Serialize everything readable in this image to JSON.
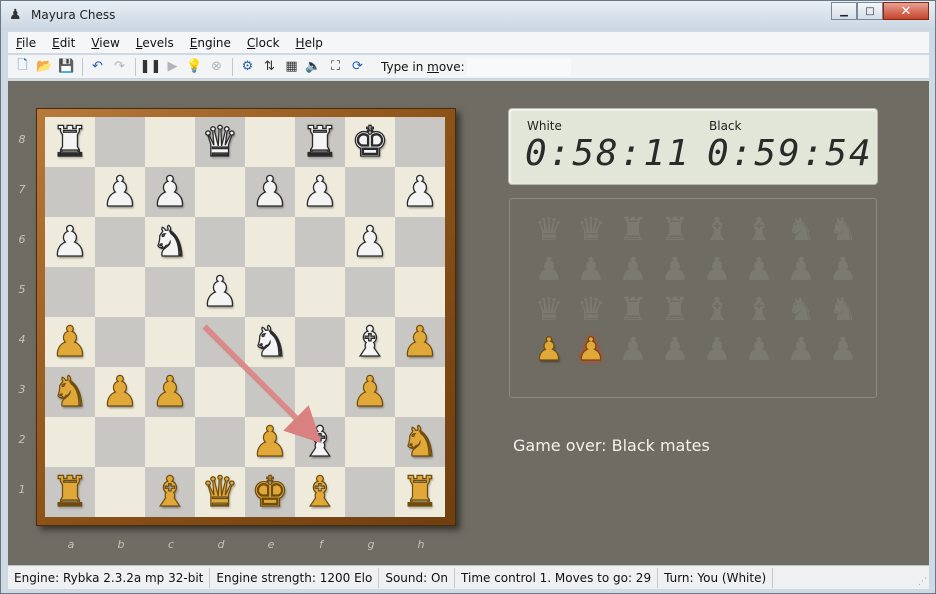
{
  "window": {
    "title": "Mayura Chess",
    "icon": "chess-pawn-icon"
  },
  "menu": [
    {
      "label": "File",
      "u": "F",
      "rest": "ile"
    },
    {
      "label": "Edit",
      "u": "E",
      "rest": "dit"
    },
    {
      "label": "View",
      "u": "V",
      "rest": "iew"
    },
    {
      "label": "Levels",
      "u": "L",
      "rest": "evels"
    },
    {
      "label": "Engine",
      "u": "E",
      "rest": "ngine"
    },
    {
      "label": "Clock",
      "u": "C",
      "rest": "lock"
    },
    {
      "label": "Help",
      "u": "H",
      "rest": "elp"
    }
  ],
  "toolbar": {
    "buttons": [
      "new-icon",
      "open-icon",
      "save-icon",
      "undo-icon",
      "redo-icon",
      "pause-icon",
      "play-icon",
      "hint-bulb-icon",
      "stop-icon",
      "options-icon",
      "flip-board-icon",
      "board-setup-icon",
      "sound-icon",
      "fit-window-icon",
      "swap-sides-icon"
    ],
    "move_label_pre": "Type in ",
    "move_label_u": "m",
    "move_label_post": "ove:",
    "move_value": ""
  },
  "board": {
    "ranks": [
      "8",
      "7",
      "6",
      "5",
      "4",
      "3",
      "2",
      "1"
    ],
    "files": [
      "a",
      "b",
      "c",
      "d",
      "e",
      "f",
      "g",
      "h"
    ],
    "position": [
      [
        "bR",
        "",
        "",
        "bQ",
        "",
        "bR",
        "bK",
        ""
      ],
      [
        "",
        "bP",
        "bP",
        "",
        "bP",
        "bP",
        "",
        "bP"
      ],
      [
        "bP",
        "",
        "bN",
        "",
        "",
        "",
        "bP",
        ""
      ],
      [
        "",
        "",
        "",
        "bP",
        "",
        "",
        "",
        ""
      ],
      [
        "wP",
        "",
        "",
        "",
        "bN",
        "",
        "bB",
        "wP"
      ],
      [
        "wN",
        "wP",
        "wP",
        "",
        "",
        "",
        "wP",
        ""
      ],
      [
        "",
        "",
        "",
        "",
        "wP",
        "bB",
        "",
        "wN"
      ],
      [
        "wR",
        "",
        "wB",
        "wQ",
        "wK",
        "wB",
        "",
        "wR"
      ]
    ],
    "last_move_arrow": {
      "from": "d4",
      "to": "f2"
    }
  },
  "clock": {
    "white_label": "White",
    "black_label": "Black",
    "white_time": "0:58:11",
    "black_time": "0:59:54"
  },
  "captured": {
    "ghost_rows": [
      [
        "♛",
        "♛",
        "♜",
        "♜",
        "♝",
        "♝",
        "♞",
        "♞"
      ],
      [
        "♟",
        "♟",
        "♟",
        "♟",
        "♟",
        "♟",
        "♟",
        "♟"
      ],
      [
        "♛",
        "♛",
        "♜",
        "♜",
        "♝",
        "♝",
        "♞",
        "♞"
      ],
      [
        "♟",
        "♟",
        "♟",
        "♟",
        "♟",
        "♟",
        "♟",
        "♟"
      ]
    ],
    "white_captured": [
      "wP",
      "wP"
    ],
    "highlighted_index": 1
  },
  "game_status": "Game over: Black mates",
  "statusbar": {
    "engine": "Engine: Rybka 2.3.2a mp 32-bit",
    "strength": "Engine strength: 1200 Elo",
    "sound": "Sound: On",
    "time_control": "Time control 1. Moves to go: 29",
    "turn": "Turn: You (White)"
  },
  "colors": {
    "background": "#6f6d63",
    "light_square": "#efebdc",
    "dark_square": "#c9c7c3",
    "white_piece": "#e0a838",
    "black_piece": "#f4f4f4",
    "arrow": "#d98080"
  }
}
